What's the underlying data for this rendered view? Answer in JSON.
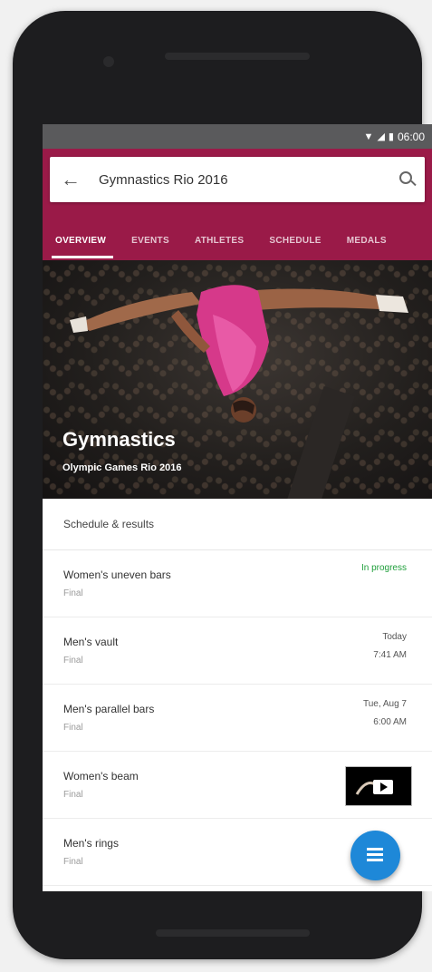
{
  "status": {
    "time": "06:00",
    "wifi_icon": "wifi-icon",
    "signal_icon": "signal-icon",
    "battery_icon": "battery-icon"
  },
  "search": {
    "query": "Gymnastics Rio 2016",
    "back_icon": "arrow-back-icon",
    "search_icon": "search-icon"
  },
  "tabs": [
    {
      "label": "OVERVIEW",
      "active": true
    },
    {
      "label": "EVENTS",
      "active": false
    },
    {
      "label": "ATHLETES",
      "active": false
    },
    {
      "label": "SCHEDULE",
      "active": false
    },
    {
      "label": "MEDALS",
      "active": false
    }
  ],
  "hero": {
    "title": "Gymnastics",
    "subtitle": "Olympic Games Rio 2016"
  },
  "schedule": {
    "header": "Schedule & results",
    "rows": [
      {
        "title": "Women's uneven bars",
        "sub": "Final",
        "status": "In progress"
      },
      {
        "title": "Men's vault",
        "sub": "Final",
        "right1": "Today",
        "right2": "7:41 AM"
      },
      {
        "title": "Men's parallel bars",
        "sub": "Final",
        "right1": "Tue, Aug 7",
        "right2": "6:00 AM"
      },
      {
        "title": "Women's beam",
        "sub": "Final",
        "thumbnail": "video-thumbnail"
      },
      {
        "title": "Men's rings",
        "sub": "Final"
      }
    ]
  },
  "colors": {
    "accent": "#9a1a48",
    "status_live": "#1e9e3a",
    "fab": "#1e88d8"
  },
  "fab_icon": "list-icon"
}
